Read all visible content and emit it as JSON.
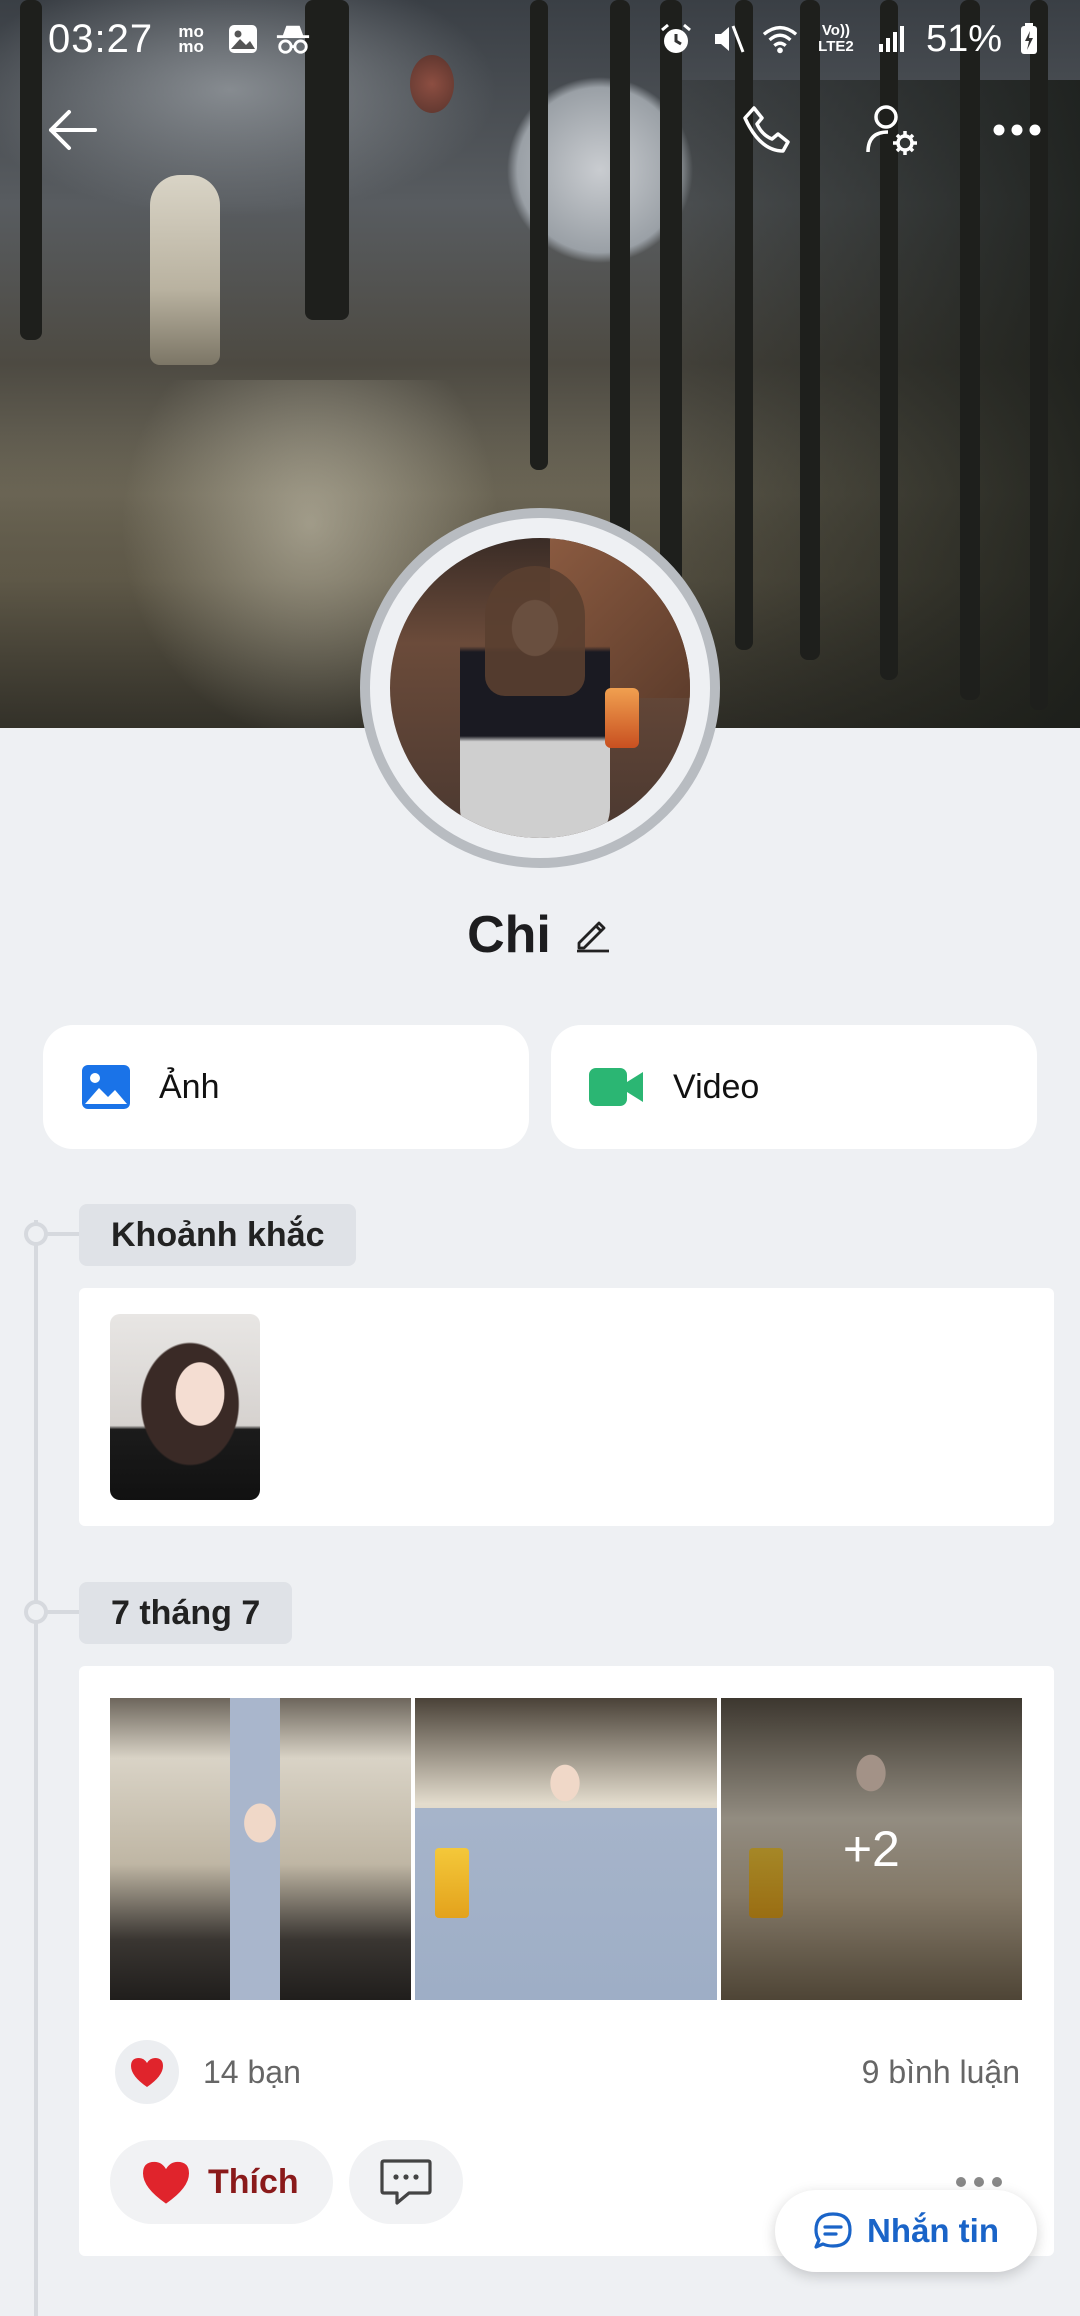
{
  "status_bar": {
    "time": "03:27",
    "app_icons": [
      "momo-icon",
      "gallery-icon",
      "incognito-icon"
    ],
    "momo_text": "mo\nmo",
    "network_label": "Vo)) LTE2",
    "battery": "51%"
  },
  "header": {
    "back_icon": "back-arrow-icon",
    "call_icon": "phone-icon",
    "settings_icon": "user-settings-icon",
    "more_icon": "more-horizontal-icon"
  },
  "profile": {
    "name": "Chi",
    "edit_icon": "pencil-icon"
  },
  "media_buttons": [
    {
      "label": "Ảnh",
      "icon": "photo-icon",
      "color": "#1a73e8"
    },
    {
      "label": "Video",
      "icon": "video-icon",
      "color": "#2bb673"
    }
  ],
  "sections": {
    "moments": {
      "label": "Khoảnh khắc"
    },
    "post": {
      "date_label": "7 tháng 7",
      "extra_photos": "+2",
      "likes": "14 bạn",
      "comments": "9 bình luận",
      "like_button": "Thích"
    }
  },
  "fab": {
    "label": "Nhắn tin",
    "icon": "chat-bubble-icon"
  },
  "colors": {
    "accent": "#1a64c8",
    "like": "#e0242c",
    "background": "#eef0f3"
  }
}
